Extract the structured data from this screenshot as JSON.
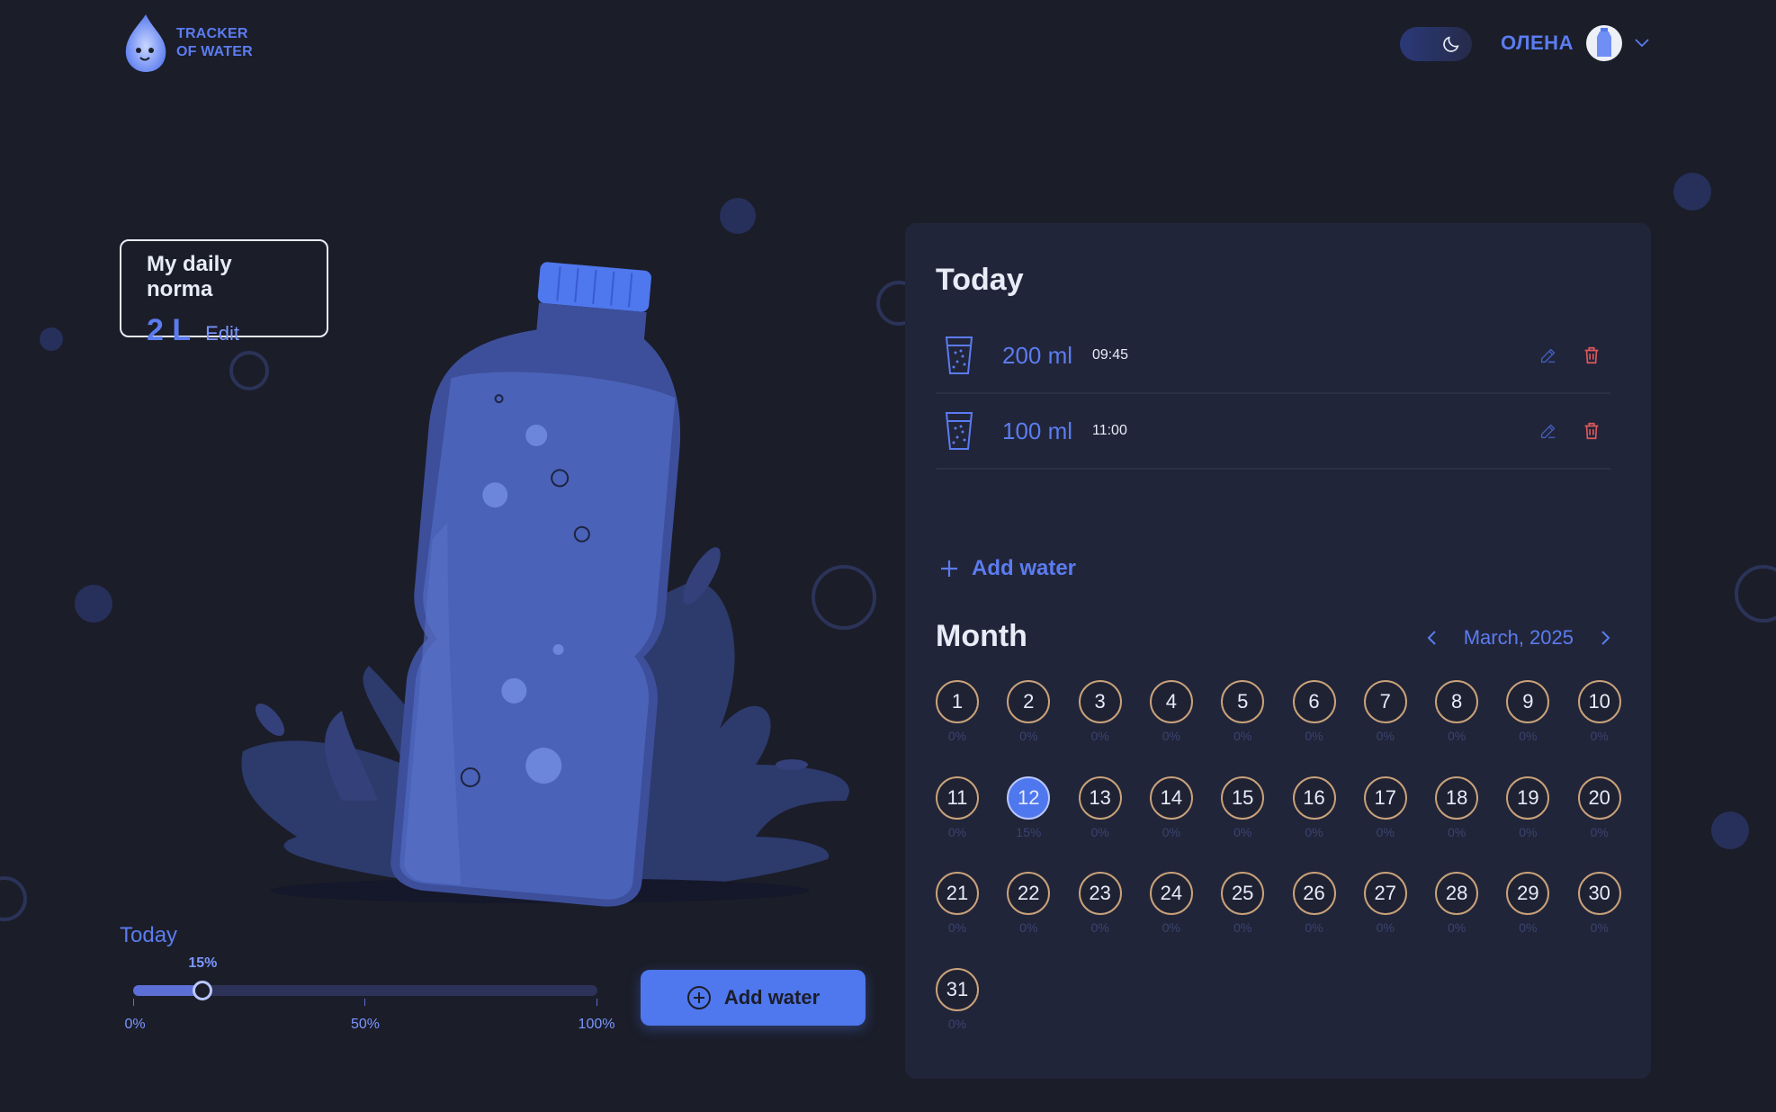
{
  "header": {
    "logo_line1": "TRACKER",
    "logo_line2": "OF WATER",
    "user_name": "ОЛЕНА"
  },
  "daily_norma": {
    "title": "My daily norma",
    "value": "2 L",
    "edit_label": "Edit"
  },
  "progress": {
    "label": "Today",
    "value_text": "15%",
    "value": 0.15,
    "ticks": [
      "0%",
      "50%",
      "100%"
    ]
  },
  "add_water_button": "Add water",
  "today_panel": {
    "title": "Today",
    "entries": [
      {
        "amount": "200 ml",
        "time": "09:45"
      },
      {
        "amount": "100 ml",
        "time": "11:00"
      }
    ],
    "add_label": "Add water"
  },
  "month_panel": {
    "title": "Month",
    "current": "March, 2025",
    "active_day": 12,
    "days": [
      {
        "d": "1",
        "p": "0%"
      },
      {
        "d": "2",
        "p": "0%"
      },
      {
        "d": "3",
        "p": "0%"
      },
      {
        "d": "4",
        "p": "0%"
      },
      {
        "d": "5",
        "p": "0%"
      },
      {
        "d": "6",
        "p": "0%"
      },
      {
        "d": "7",
        "p": "0%"
      },
      {
        "d": "8",
        "p": "0%"
      },
      {
        "d": "9",
        "p": "0%"
      },
      {
        "d": "10",
        "p": "0%"
      },
      {
        "d": "11",
        "p": "0%"
      },
      {
        "d": "12",
        "p": "15%"
      },
      {
        "d": "13",
        "p": "0%"
      },
      {
        "d": "14",
        "p": "0%"
      },
      {
        "d": "15",
        "p": "0%"
      },
      {
        "d": "16",
        "p": "0%"
      },
      {
        "d": "17",
        "p": "0%"
      },
      {
        "d": "18",
        "p": "0%"
      },
      {
        "d": "19",
        "p": "0%"
      },
      {
        "d": "20",
        "p": "0%"
      },
      {
        "d": "21",
        "p": "0%"
      },
      {
        "d": "22",
        "p": "0%"
      },
      {
        "d": "23",
        "p": "0%"
      },
      {
        "d": "24",
        "p": "0%"
      },
      {
        "d": "25",
        "p": "0%"
      },
      {
        "d": "26",
        "p": "0%"
      },
      {
        "d": "27",
        "p": "0%"
      },
      {
        "d": "28",
        "p": "0%"
      },
      {
        "d": "29",
        "p": "0%"
      },
      {
        "d": "30",
        "p": "0%"
      },
      {
        "d": "31",
        "p": "0%"
      }
    ]
  },
  "colors": {
    "background": "#1b1d29",
    "panel": "#212539",
    "accent": "#5b7cf0",
    "button": "#4f77ee",
    "day_border": "#c9a27a",
    "delete": "#e0575b"
  }
}
